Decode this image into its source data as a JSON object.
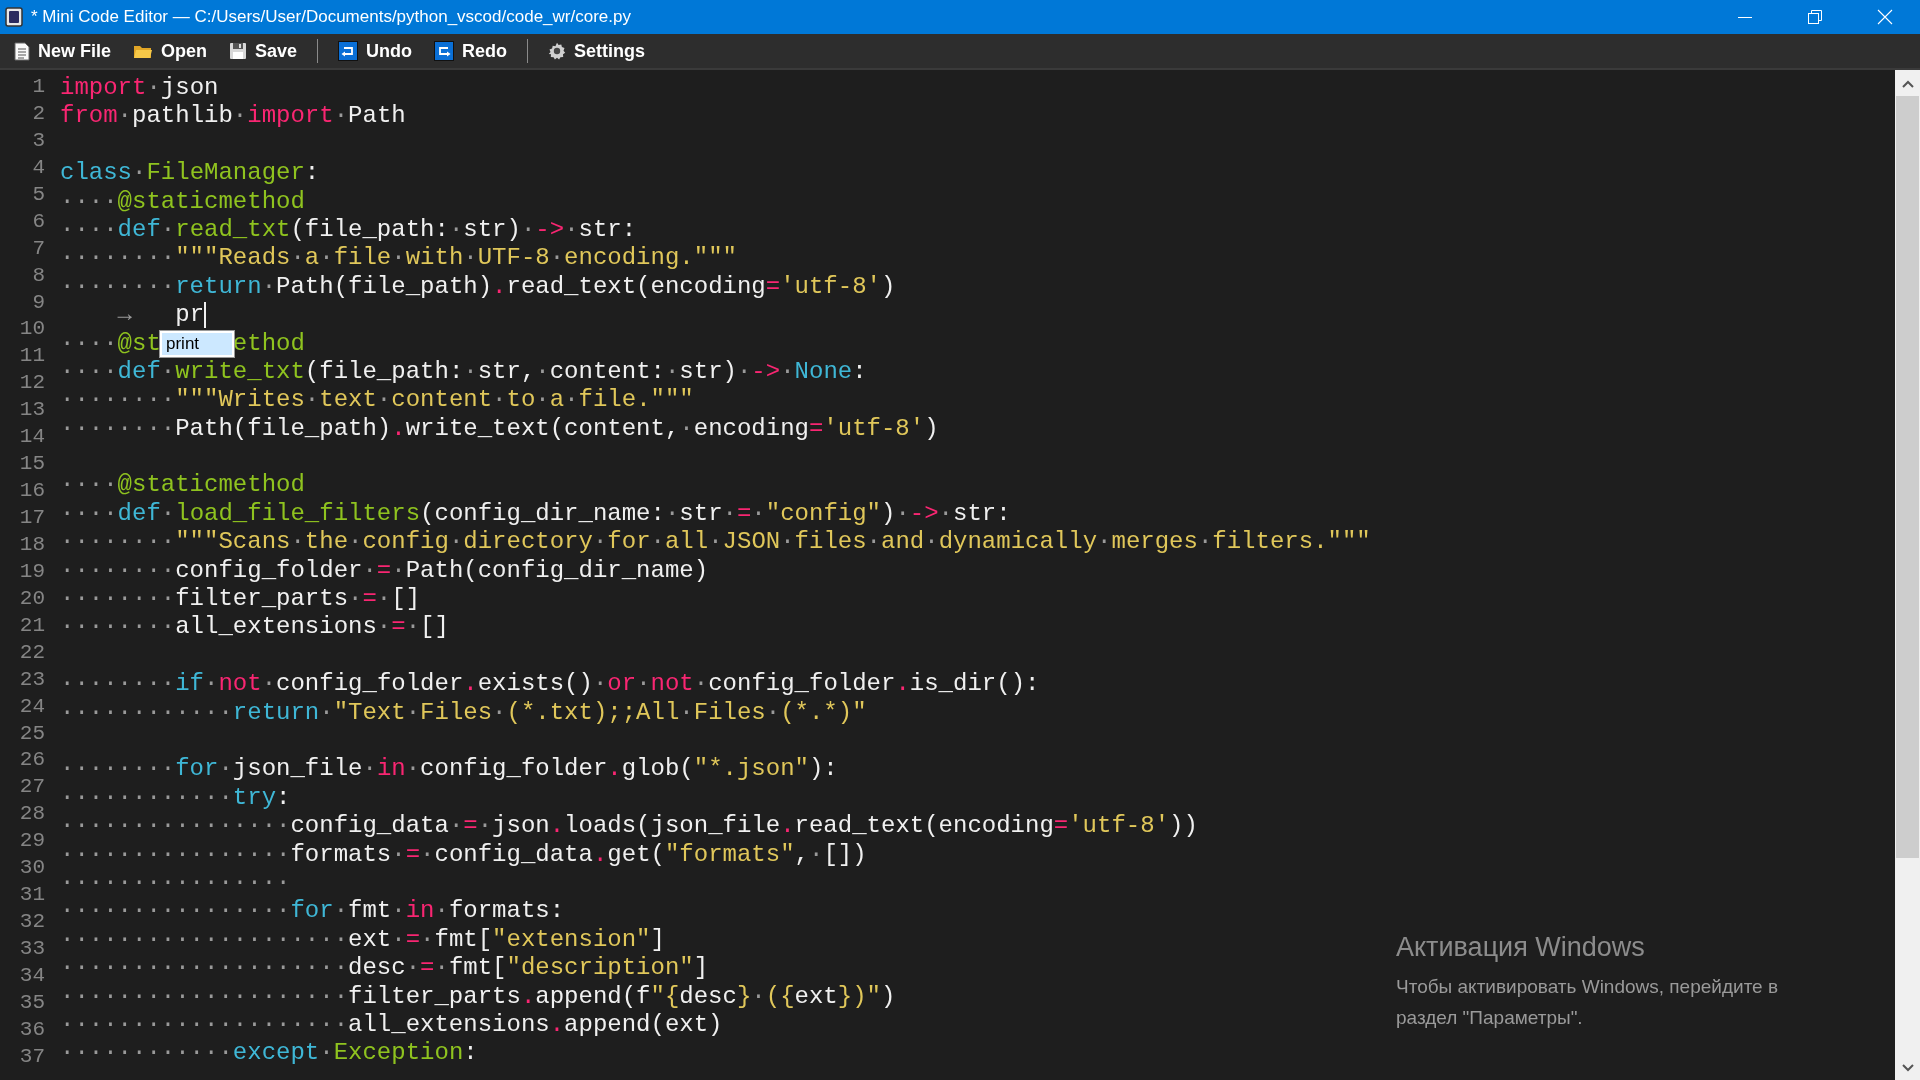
{
  "window": {
    "title": "* Mini Code Editor — C:/Users/User/Documents/python_vscod/code_wr/core.py"
  },
  "toolbar": [
    {
      "kind": "new",
      "label": "New File"
    },
    {
      "kind": "open",
      "label": "Open"
    },
    {
      "kind": "save",
      "label": "Save"
    },
    {
      "kind": "separator"
    },
    {
      "kind": "undo",
      "label": "Undo"
    },
    {
      "kind": "redo",
      "label": "Redo"
    },
    {
      "kind": "separator"
    },
    {
      "kind": "settings",
      "label": "Settings"
    }
  ],
  "editor": {
    "line_numbers": [
      "1",
      "2",
      "3",
      "4",
      "5",
      "6",
      "7",
      "8",
      "9",
      "10",
      "11",
      "12",
      "13",
      "14",
      "15",
      "16",
      "17",
      "18",
      "19",
      "20",
      "21",
      "22",
      "23",
      "24",
      "25",
      "26",
      "27",
      "28",
      "29",
      "30",
      "31",
      "32",
      "33",
      "34",
      "35",
      "36",
      "37"
    ],
    "lines": [
      {
        "tokens": [
          {
            "kind": "kw",
            "text": "import"
          },
          {
            "kind": "txt",
            "text": "·json"
          }
        ]
      },
      {
        "tokens": [
          {
            "kind": "kw",
            "text": "from"
          },
          {
            "kind": "txt",
            "text": "·pathlib·"
          },
          {
            "kind": "kw",
            "text": "import"
          },
          {
            "kind": "txt",
            "text": "·Path"
          }
        ]
      },
      {
        "kind": "blank"
      },
      {
        "tokens": [
          {
            "kind": "key",
            "text": "class"
          },
          {
            "kind": "txt",
            "text": "·"
          },
          {
            "kind": "name",
            "text": "FileManager"
          },
          {
            "kind": "txt",
            "text": ":"
          }
        ]
      },
      {
        "tokens": [
          {
            "kind": "txt",
            "text": "····"
          },
          {
            "kind": "name",
            "text": "@staticmethod"
          }
        ]
      },
      {
        "tokens": [
          {
            "kind": "txt",
            "text": "····"
          },
          {
            "kind": "key",
            "text": "def"
          },
          {
            "kind": "txt",
            "text": "·"
          },
          {
            "kind": "name",
            "text": "read_txt"
          },
          {
            "kind": "txt",
            "text": "(file_path:·str)·"
          },
          {
            "kind": "kw",
            "text": "->"
          },
          {
            "kind": "txt",
            "text": "·str:"
          }
        ]
      },
      {
        "tokens": [
          {
            "kind": "txt",
            "text": "········"
          },
          {
            "kind": "str",
            "text": "\"\"\"Reads·a·file·with·UTF-8·encoding.\"\"\""
          }
        ]
      },
      {
        "tokens": [
          {
            "kind": "txt",
            "text": "········"
          },
          {
            "kind": "key",
            "text": "return"
          },
          {
            "kind": "txt",
            "text": "·Path(file_path)"
          },
          {
            "kind": "kw",
            "text": "."
          },
          {
            "kind": "txt",
            "text": "read_text(encoding"
          },
          {
            "kind": "kw",
            "text": "="
          },
          {
            "kind": "str",
            "text": "'utf-8'"
          },
          {
            "kind": "txt",
            "text": ")"
          }
        ]
      },
      {
        "tokens": [
          {
            "kind": "txt",
            "text": "    →   pr"
          },
          {
            "kind": "caret"
          }
        ]
      },
      {
        "kind": "covered",
        "parts": [
          {
            "tokens": [
              {
                "kind": "txt",
                "text": "····"
              },
              {
                "kind": "name",
                "text": "@st"
              }
            ]
          },
          {
            "tokens": [
              {
                "kind": "name",
                "text": "ethod"
              }
            ]
          }
        ]
      },
      {
        "tokens": [
          {
            "kind": "txt",
            "text": "····"
          },
          {
            "kind": "key",
            "text": "def"
          },
          {
            "kind": "txt",
            "text": "·"
          },
          {
            "kind": "name",
            "text": "write_txt"
          },
          {
            "kind": "txt",
            "text": "(file_path:·str,·content:·str)·"
          },
          {
            "kind": "kw",
            "text": "->"
          },
          {
            "kind": "txt",
            "text": "·"
          },
          {
            "kind": "key",
            "text": "None"
          },
          {
            "kind": "txt",
            "text": ":"
          }
        ]
      },
      {
        "tokens": [
          {
            "kind": "txt",
            "text": "········"
          },
          {
            "kind": "str",
            "text": "\"\"\"Writes·text·content·to·a·file.\"\"\""
          }
        ]
      },
      {
        "tokens": [
          {
            "kind": "txt",
            "text": "········Path(file_path)"
          },
          {
            "kind": "kw",
            "text": "."
          },
          {
            "kind": "txt",
            "text": "write_text(content,·encoding"
          },
          {
            "kind": "kw",
            "text": "="
          },
          {
            "kind": "str",
            "text": "'utf-8'"
          },
          {
            "kind": "txt",
            "text": ")"
          }
        ]
      },
      {
        "kind": "blank"
      },
      {
        "tokens": [
          {
            "kind": "txt",
            "text": "····"
          },
          {
            "kind": "name",
            "text": "@staticmethod"
          }
        ]
      },
      {
        "tokens": [
          {
            "kind": "txt",
            "text": "····"
          },
          {
            "kind": "key",
            "text": "def"
          },
          {
            "kind": "txt",
            "text": "·"
          },
          {
            "kind": "name",
            "text": "load_file_filters"
          },
          {
            "kind": "txt",
            "text": "(config_dir_name:·str·"
          },
          {
            "kind": "kw",
            "text": "="
          },
          {
            "kind": "txt",
            "text": "·"
          },
          {
            "kind": "str",
            "text": "\"config\""
          },
          {
            "kind": "txt",
            "text": ")·"
          },
          {
            "kind": "kw",
            "text": "->"
          },
          {
            "kind": "txt",
            "text": "·str:"
          }
        ]
      },
      {
        "tokens": [
          {
            "kind": "txt",
            "text": "········"
          },
          {
            "kind": "str",
            "text": "\"\"\"Scans·the·config·directory·for·all·JSON·files·and·dynamically·merges·filters.\"\"\""
          }
        ]
      },
      {
        "tokens": [
          {
            "kind": "txt",
            "text": "········config_folder·"
          },
          {
            "kind": "kw",
            "text": "="
          },
          {
            "kind": "txt",
            "text": "·Path(config_dir_name)"
          }
        ]
      },
      {
        "tokens": [
          {
            "kind": "txt",
            "text": "········filter_parts·"
          },
          {
            "kind": "kw",
            "text": "="
          },
          {
            "kind": "txt",
            "text": "·[]"
          }
        ]
      },
      {
        "tokens": [
          {
            "kind": "txt",
            "text": "········all_extensions·"
          },
          {
            "kind": "kw",
            "text": "="
          },
          {
            "kind": "txt",
            "text": "·[]"
          }
        ]
      },
      {
        "kind": "blank"
      },
      {
        "tokens": [
          {
            "kind": "txt",
            "text": "········"
          },
          {
            "kind": "key",
            "text": "if"
          },
          {
            "kind": "txt",
            "text": "·"
          },
          {
            "kind": "kw",
            "text": "not"
          },
          {
            "kind": "txt",
            "text": "·config_folder"
          },
          {
            "kind": "kw",
            "text": "."
          },
          {
            "kind": "txt",
            "text": "exists()·"
          },
          {
            "kind": "kw",
            "text": "or"
          },
          {
            "kind": "txt",
            "text": "·"
          },
          {
            "kind": "kw",
            "text": "not"
          },
          {
            "kind": "txt",
            "text": "·config_folder"
          },
          {
            "kind": "kw",
            "text": "."
          },
          {
            "kind": "txt",
            "text": "is_dir():"
          }
        ]
      },
      {
        "tokens": [
          {
            "kind": "txt",
            "text": "············"
          },
          {
            "kind": "key",
            "text": "return"
          },
          {
            "kind": "txt",
            "text": "·"
          },
          {
            "kind": "str",
            "text": "\"Text·Files·(*.txt);;All·Files·(*.*)\""
          }
        ]
      },
      {
        "kind": "blank"
      },
      {
        "tokens": [
          {
            "kind": "txt",
            "text": "········"
          },
          {
            "kind": "key",
            "text": "for"
          },
          {
            "kind": "txt",
            "text": "·json_file·"
          },
          {
            "kind": "kw",
            "text": "in"
          },
          {
            "kind": "txt",
            "text": "·config_folder"
          },
          {
            "kind": "kw",
            "text": "."
          },
          {
            "kind": "txt",
            "text": "glob("
          },
          {
            "kind": "str",
            "text": "\"*.json\""
          },
          {
            "kind": "txt",
            "text": "):"
          }
        ]
      },
      {
        "tokens": [
          {
            "kind": "txt",
            "text": "············"
          },
          {
            "kind": "key",
            "text": "try"
          },
          {
            "kind": "txt",
            "text": ":"
          }
        ]
      },
      {
        "tokens": [
          {
            "kind": "txt",
            "text": "················config_data·"
          },
          {
            "kind": "kw",
            "text": "="
          },
          {
            "kind": "txt",
            "text": "·json"
          },
          {
            "kind": "kw",
            "text": "."
          },
          {
            "kind": "txt",
            "text": "loads(json_file"
          },
          {
            "kind": "kw",
            "text": "."
          },
          {
            "kind": "txt",
            "text": "read_text(encoding"
          },
          {
            "kind": "kw",
            "text": "="
          },
          {
            "kind": "str",
            "text": "'utf-8'"
          },
          {
            "kind": "txt",
            "text": "))"
          }
        ]
      },
      {
        "tokens": [
          {
            "kind": "txt",
            "text": "················formats·"
          },
          {
            "kind": "kw",
            "text": "="
          },
          {
            "kind": "txt",
            "text": "·config_data"
          },
          {
            "kind": "kw",
            "text": "."
          },
          {
            "kind": "txt",
            "text": "get("
          },
          {
            "kind": "str",
            "text": "\"formats\""
          },
          {
            "kind": "txt",
            "text": ",·[])"
          }
        ]
      },
      {
        "tokens": [
          {
            "kind": "txt",
            "text": "················"
          }
        ]
      },
      {
        "tokens": [
          {
            "kind": "txt",
            "text": "················"
          },
          {
            "kind": "key",
            "text": "for"
          },
          {
            "kind": "txt",
            "text": "·fmt·"
          },
          {
            "kind": "kw",
            "text": "in"
          },
          {
            "kind": "txt",
            "text": "·formats:"
          }
        ]
      },
      {
        "tokens": [
          {
            "kind": "txt",
            "text": "····················ext·"
          },
          {
            "kind": "kw",
            "text": "="
          },
          {
            "kind": "txt",
            "text": "·fmt["
          },
          {
            "kind": "str",
            "text": "\"extension\""
          },
          {
            "kind": "txt",
            "text": "]"
          }
        ]
      },
      {
        "tokens": [
          {
            "kind": "txt",
            "text": "····················desc·"
          },
          {
            "kind": "kw",
            "text": "="
          },
          {
            "kind": "txt",
            "text": "·fmt["
          },
          {
            "kind": "str",
            "text": "\"description\""
          },
          {
            "kind": "txt",
            "text": "]"
          }
        ]
      },
      {
        "tokens": [
          {
            "kind": "txt",
            "text": "····················filter_parts"
          },
          {
            "kind": "kw",
            "text": "."
          },
          {
            "kind": "txt",
            "text": "append(f"
          },
          {
            "kind": "str",
            "text": "\"{"
          },
          {
            "kind": "txt",
            "text": "desc"
          },
          {
            "kind": "str",
            "text": "}·({"
          },
          {
            "kind": "txt",
            "text": "ext"
          },
          {
            "kind": "str",
            "text": "})\""
          },
          {
            "kind": "txt",
            "text": ")"
          }
        ]
      },
      {
        "tokens": [
          {
            "kind": "txt",
            "text": "····················all_extensions"
          },
          {
            "kind": "kw",
            "text": "."
          },
          {
            "kind": "txt",
            "text": "append(ext)"
          }
        ]
      },
      {
        "tokens": [
          {
            "kind": "txt",
            "text": "············"
          },
          {
            "kind": "key",
            "text": "except"
          },
          {
            "kind": "txt",
            "text": "·"
          },
          {
            "kind": "name",
            "text": "Exception"
          },
          {
            "kind": "txt",
            "text": ":"
          }
        ]
      }
    ],
    "autocomplete": {
      "items": [
        {
          "label": "print",
          "selected": true
        }
      ]
    }
  },
  "activation_notice": {
    "title": "Активация Windows",
    "lines": [
      "Чтобы активировать Windows, перейдите в",
      "раздел \"Параметры\"."
    ]
  }
}
